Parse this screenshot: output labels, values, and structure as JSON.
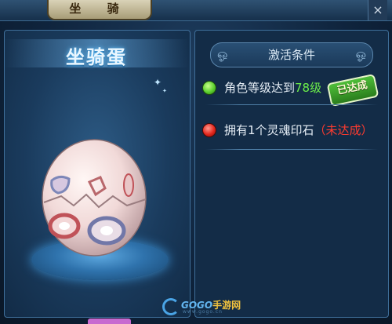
{
  "window": {
    "title": "坐 骑",
    "close_label": "×"
  },
  "mount_panel": {
    "item_name": "坐骑蛋"
  },
  "conditions_panel": {
    "header": "激活条件",
    "conditions": [
      {
        "prefix": "角色等级达到",
        "highlight": "78级",
        "status": "met",
        "status_label": "已达成",
        "dot_color": "#5ccf2f"
      },
      {
        "prefix": "拥有1个灵魂印石",
        "highlight": "",
        "status": "unmet",
        "status_label": "（未达成）",
        "dot_color": "#e3271d"
      }
    ]
  },
  "watermark": {
    "brand": "GOGO",
    "brand_cn": "手游网",
    "url": "www.gogo.cn"
  }
}
